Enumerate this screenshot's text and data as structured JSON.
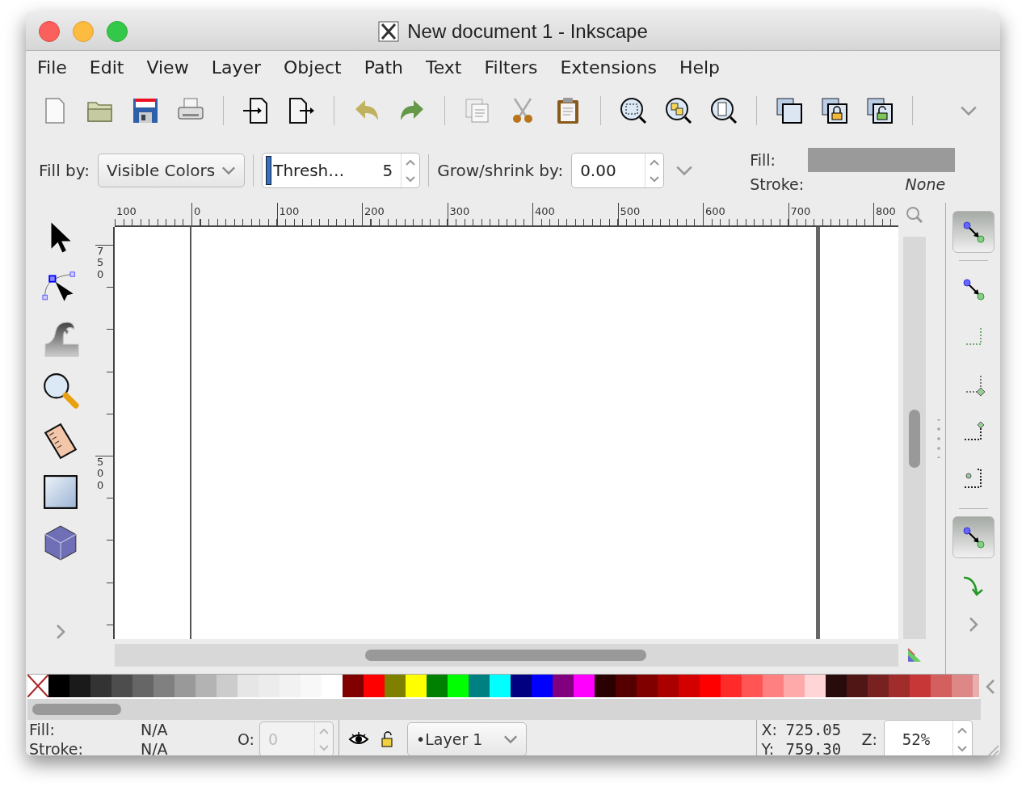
{
  "window": {
    "title": "New document 1 - Inkscape"
  },
  "menu": [
    "File",
    "Edit",
    "View",
    "Layer",
    "Object",
    "Path",
    "Text",
    "Filters",
    "Extensions",
    "Help"
  ],
  "tool_controls": {
    "fill_by_label": "Fill by:",
    "fill_by_value": "Visible Colors",
    "threshold_label": "Thresh…",
    "threshold_value": "5",
    "grow_label": "Grow/shrink by:",
    "grow_value": "0.00",
    "fill_label": "Fill:",
    "stroke_label": "Stroke:",
    "stroke_value": "None"
  },
  "ruler": {
    "h_labels": [
      "100",
      "0",
      "100",
      "200",
      "300",
      "400",
      "500",
      "600",
      "700",
      "800"
    ],
    "v_labels": [
      "750",
      "500"
    ]
  },
  "snap_bar": {
    "groups": [
      [
        {
          "kind": "nodes-arrow",
          "on": true
        }
      ],
      [
        {
          "kind": "nodes-arrow",
          "on": false
        },
        {
          "kind": "dotted-corner",
          "on": false
        },
        {
          "kind": "dotted-corner-diamond",
          "on": false
        },
        {
          "kind": "dotted-corner-top",
          "on": false
        },
        {
          "kind": "dotted-corner-dot",
          "on": false
        }
      ],
      [
        {
          "kind": "nodes-arrow",
          "on": true
        },
        {
          "kind": "curve",
          "on": false
        }
      ]
    ]
  },
  "palette": [
    {
      "color": "#000000"
    },
    {
      "color": "#1a1a1a"
    },
    {
      "color": "#333333"
    },
    {
      "color": "#4d4d4d"
    },
    {
      "color": "#666666"
    },
    {
      "color": "#808080"
    },
    {
      "color": "#999999"
    },
    {
      "color": "#b3b3b3"
    },
    {
      "color": "#cccccc"
    },
    {
      "color": "#e6e6e6"
    },
    {
      "color": "#ececec"
    },
    {
      "color": "#f2f2f2"
    },
    {
      "color": "#f8f8f8"
    },
    {
      "color": "#ffffff"
    },
    {
      "color": "#800000"
    },
    {
      "color": "#ff0000"
    },
    {
      "color": "#808000"
    },
    {
      "color": "#ffff00"
    },
    {
      "color": "#008000"
    },
    {
      "color": "#00ff00"
    },
    {
      "color": "#008080"
    },
    {
      "color": "#00ffff"
    },
    {
      "color": "#000080"
    },
    {
      "color": "#0000ff"
    },
    {
      "color": "#800080"
    },
    {
      "color": "#ff00ff"
    },
    {
      "color": "#2b0000"
    },
    {
      "color": "#550000"
    },
    {
      "color": "#800000"
    },
    {
      "color": "#aa0000"
    },
    {
      "color": "#d40000"
    },
    {
      "color": "#ff0000"
    },
    {
      "color": "#ff2a2a"
    },
    {
      "color": "#ff5555"
    },
    {
      "color": "#ff8080"
    },
    {
      "color": "#ffaaaa"
    },
    {
      "color": "#ffd5d5"
    },
    {
      "color": "#280b0b"
    },
    {
      "color": "#501616"
    },
    {
      "color": "#782121"
    },
    {
      "color": "#a02c2c"
    },
    {
      "color": "#c83737"
    },
    {
      "color": "#d35f5f"
    },
    {
      "color": "#de8787"
    },
    {
      "color": "#e9afaf"
    }
  ],
  "status": {
    "fill_label": "Fill:",
    "fill_value": "N/A",
    "stroke_label": "Stroke:",
    "stroke_value": "N/A",
    "opacity_label": "O:",
    "opacity_value": "0",
    "opacity_disabled": true,
    "layer": "•Layer 1",
    "x_label": "X:",
    "x_value": "725.05",
    "y_label": "Y:",
    "y_value": "759.30",
    "zoom_label": "Z:",
    "zoom_value": "52%"
  }
}
